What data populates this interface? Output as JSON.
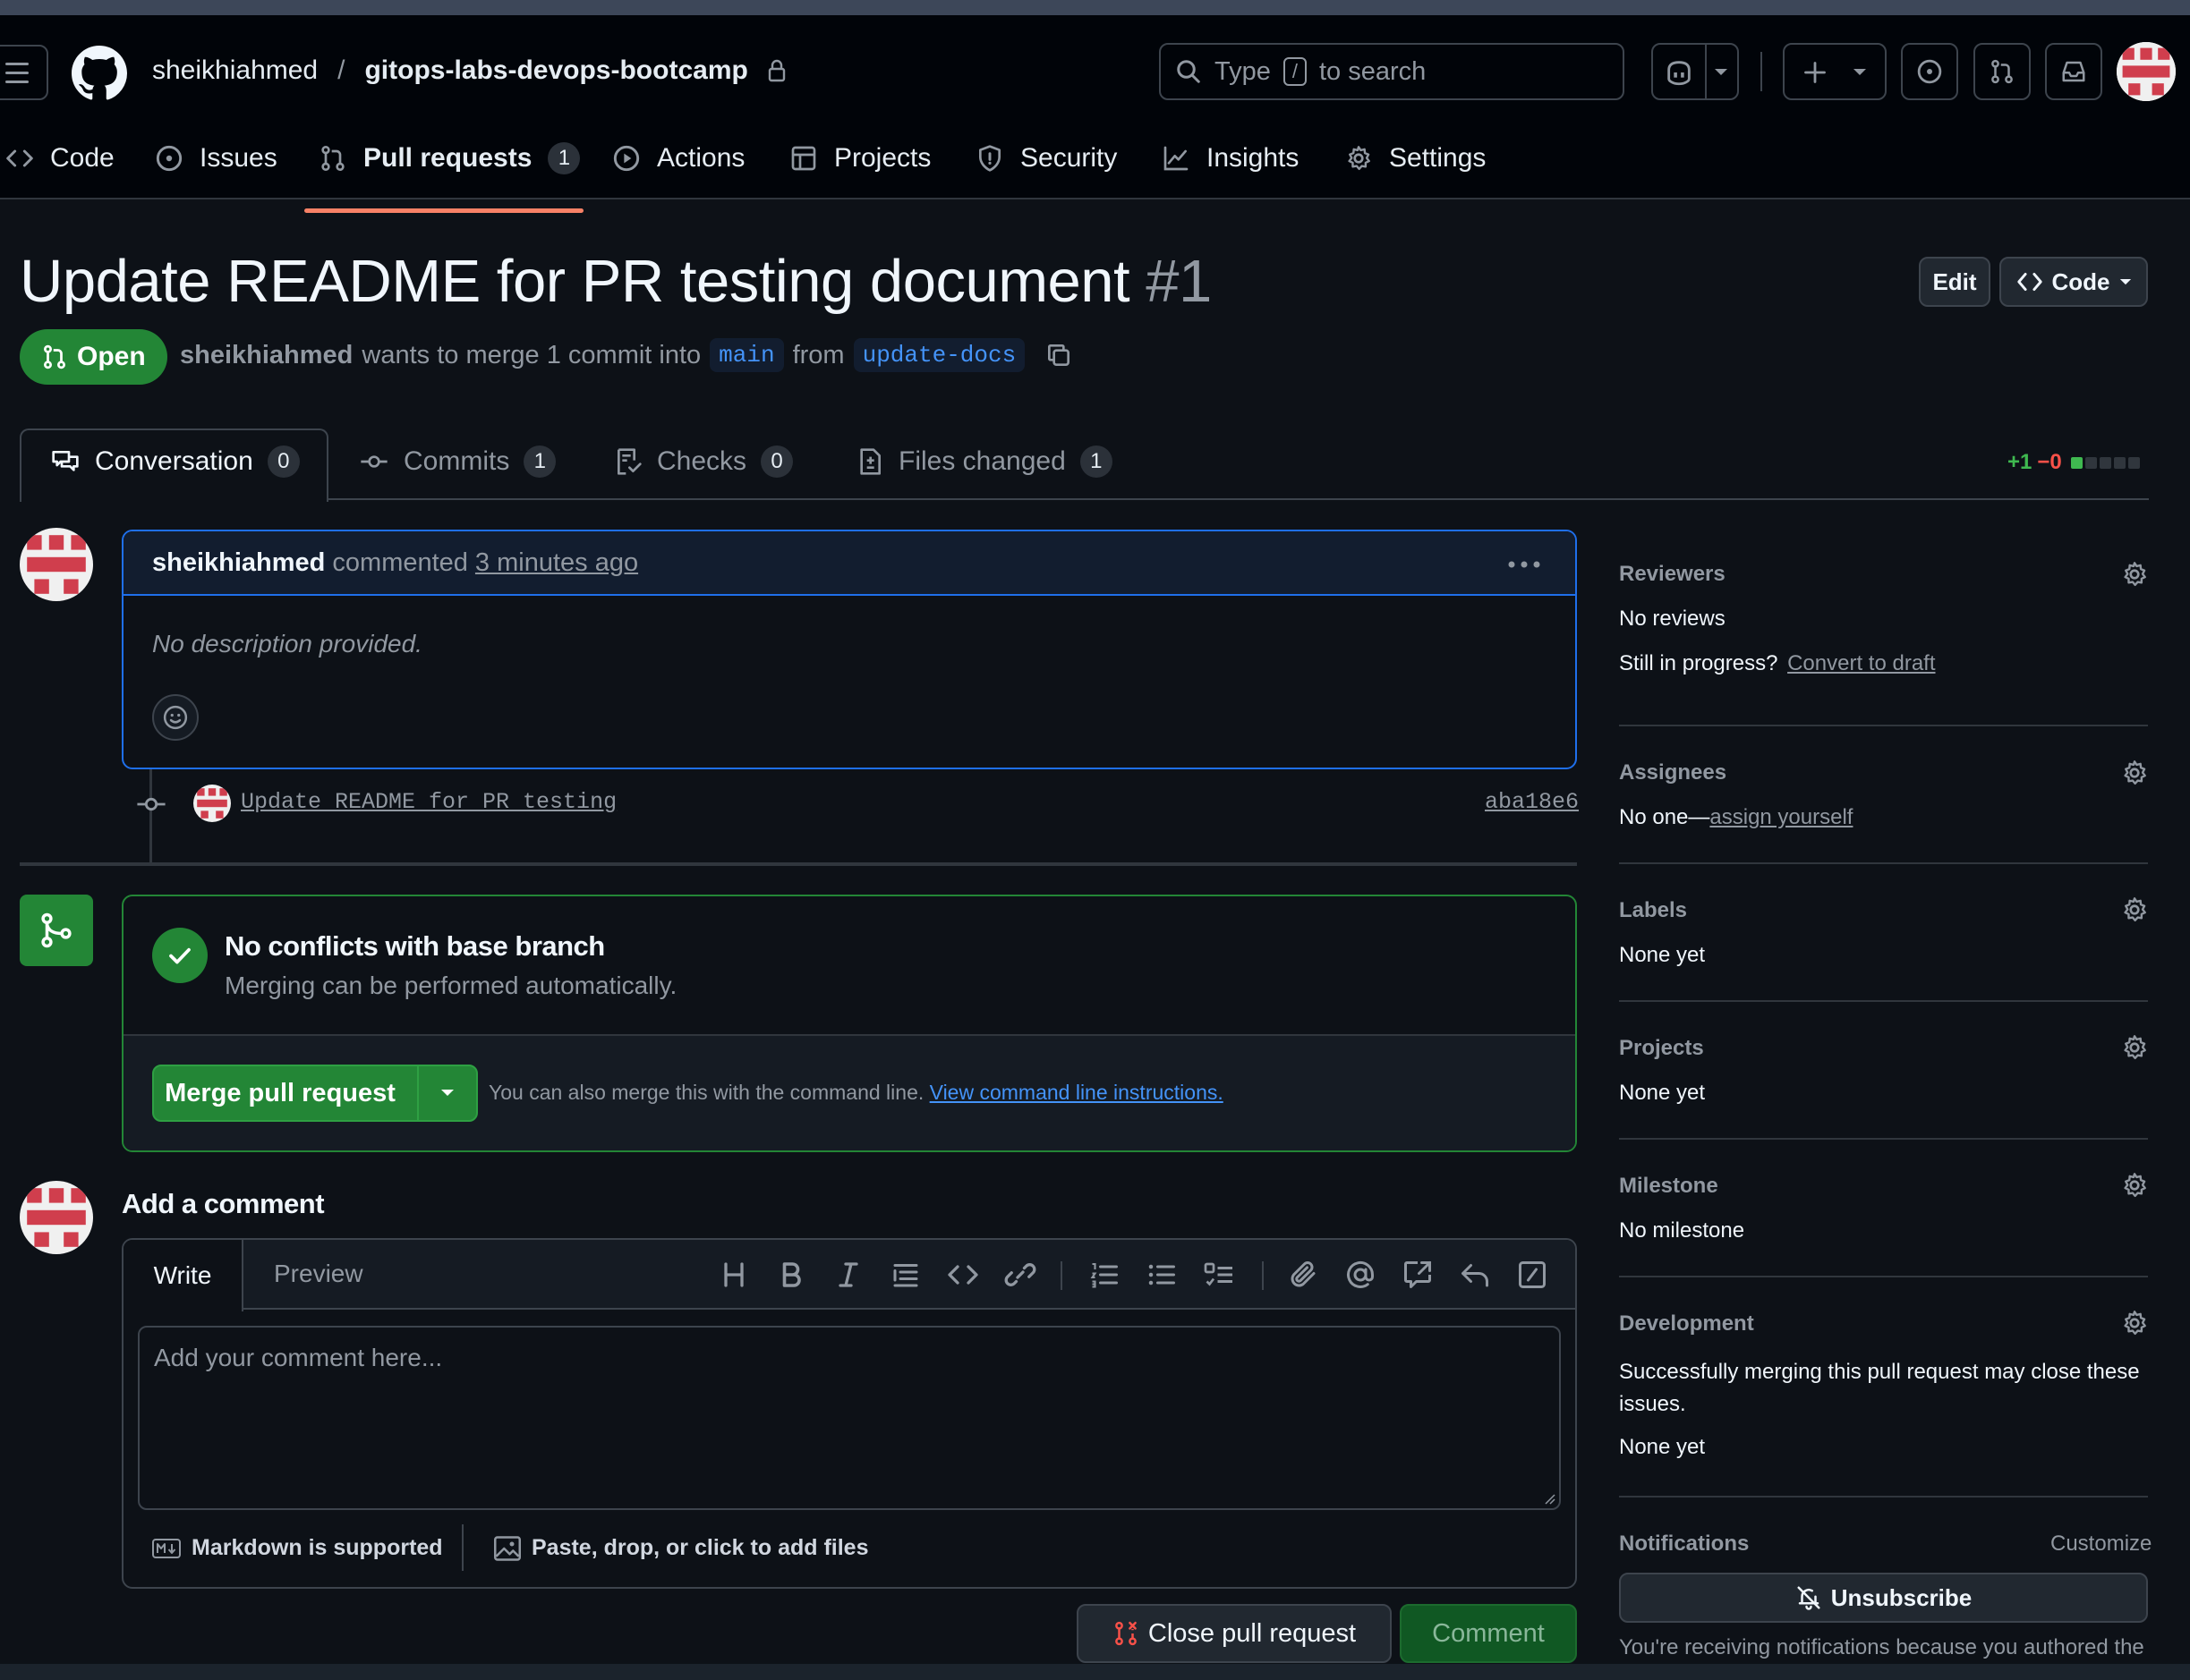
{
  "header": {
    "owner": "sheikhiahmed",
    "separator": "/",
    "repo": "gitops-labs-devops-bootcamp",
    "search_prefix": "Type",
    "search_key": "/",
    "search_suffix": "to search"
  },
  "repo_nav": {
    "code": "Code",
    "issues": "Issues",
    "pull_requests": "Pull requests",
    "pull_requests_count": "1",
    "actions": "Actions",
    "projects": "Projects",
    "security": "Security",
    "insights": "Insights",
    "settings": "Settings"
  },
  "pr": {
    "title": "Update README for PR testing document",
    "number": "#1",
    "status": "Open",
    "author": "sheikhiahmed",
    "merge_text": "wants to merge 1 commit into",
    "base_branch": "main",
    "from_text": "from",
    "head_branch": "update-docs",
    "edit_label": "Edit",
    "code_label": "Code"
  },
  "tabs": {
    "conversation": "Conversation",
    "conversation_count": "0",
    "commits": "Commits",
    "commits_count": "1",
    "checks": "Checks",
    "checks_count": "0",
    "files_changed": "Files changed",
    "files_changed_count": "1",
    "additions": "+1",
    "deletions": "−0"
  },
  "comment": {
    "author": "sheikhiahmed",
    "action": "commented",
    "time": "3 minutes ago",
    "body": "No description provided."
  },
  "commit": {
    "message": "Update README for PR testing",
    "sha": "aba18e6"
  },
  "merge": {
    "title": "No conflicts with base branch",
    "subtitle": "Merging can be performed automatically.",
    "button": "Merge pull request",
    "hint": "You can also merge this with the command line.",
    "hint_link": "View command line instructions."
  },
  "add_comment": {
    "heading": "Add a comment",
    "tab_write": "Write",
    "tab_preview": "Preview",
    "placeholder": "Add your comment here...",
    "markdown": "Markdown is supported",
    "files": "Paste, drop, or click to add files",
    "close_button": "Close pull request",
    "comment_button": "Comment"
  },
  "sidebar": {
    "reviewers": "Reviewers",
    "reviewers_value": "No reviews",
    "in_progress": "Still in progress?",
    "convert_draft": "Convert to draft",
    "assignees": "Assignees",
    "assignees_value": "No one—",
    "assign_yourself": "assign yourself",
    "labels": "Labels",
    "labels_value": "None yet",
    "projects": "Projects",
    "projects_value": "None yet",
    "milestone": "Milestone",
    "milestone_value": "No milestone",
    "development": "Development",
    "development_text": "Successfully merging this pull request may close these issues.",
    "development_value": "None yet",
    "notifications": "Notifications",
    "customize": "Customize",
    "unsubscribe": "Unsubscribe",
    "notify_reason": "You're receiving notifications because you authored the"
  },
  "colors": {
    "accent": "#4493f8",
    "open_green": "#238636",
    "tab_underline": "#f78166",
    "addition": "#3fb950",
    "deletion": "#f85149"
  }
}
